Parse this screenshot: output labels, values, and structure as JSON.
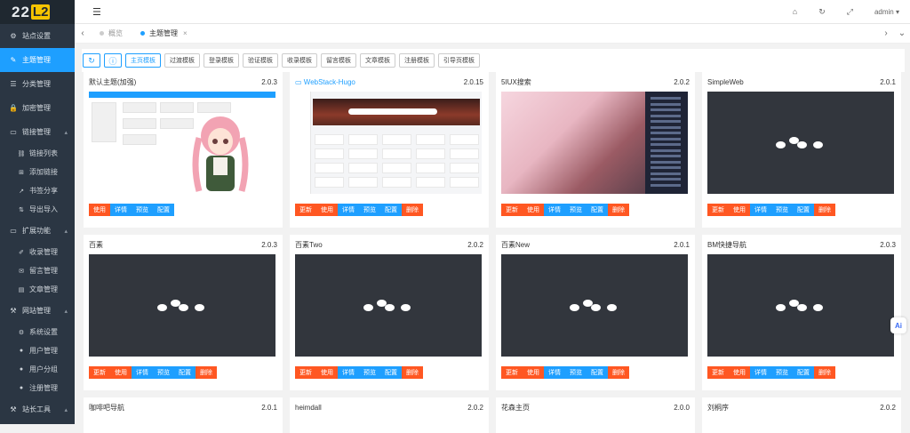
{
  "logo": {
    "text_a": "22",
    "text_b": "L2"
  },
  "header": {
    "user": "admin",
    "user_caret": "▾"
  },
  "tabs": [
    {
      "label": "概览",
      "active": false
    },
    {
      "label": "主题管理",
      "active": true,
      "close": "×"
    }
  ],
  "sidebar": {
    "items": [
      {
        "label": "站点设置",
        "icon": "gear-icon",
        "glyph": "⚙"
      },
      {
        "label": "主题管理",
        "icon": "brush-icon",
        "glyph": "✎",
        "active": true
      },
      {
        "label": "分类管理",
        "icon": "list-icon",
        "glyph": "☰"
      },
      {
        "label": "加密管理",
        "icon": "lock-icon",
        "glyph": "🔒"
      },
      {
        "label": "链接管理",
        "icon": "folder-icon",
        "glyph": "▭",
        "arrow": "▴"
      },
      {
        "label": "链接列表",
        "icon": "link-icon",
        "glyph": "⛓",
        "sub": true
      },
      {
        "label": "添加链接",
        "icon": "plus-square-icon",
        "glyph": "⊞",
        "sub": true
      },
      {
        "label": "书签分享",
        "icon": "share-icon",
        "glyph": "↗",
        "sub": true
      },
      {
        "label": "导出导入",
        "icon": "swap-icon",
        "glyph": "⇅",
        "sub": true
      },
      {
        "label": "扩展功能",
        "icon": "folder-icon",
        "glyph": "▭",
        "arrow": "▴"
      },
      {
        "label": "收录管理",
        "icon": "pencil-icon",
        "glyph": "✐",
        "sub": true
      },
      {
        "label": "留言管理",
        "icon": "message-icon",
        "glyph": "✉",
        "sub": true
      },
      {
        "label": "文章管理",
        "icon": "doc-icon",
        "glyph": "▤",
        "sub": true
      },
      {
        "label": "网站管理",
        "icon": "wrench-icon",
        "glyph": "⚒",
        "arrow": "▴"
      },
      {
        "label": "系统设置",
        "icon": "cogs-icon",
        "glyph": "⚙",
        "sub": true
      },
      {
        "label": "用户管理",
        "icon": "user-icon",
        "glyph": "●",
        "sub": true
      },
      {
        "label": "用户分组",
        "icon": "users-icon",
        "glyph": "●",
        "sub": true
      },
      {
        "label": "注册管理",
        "icon": "user-plus-icon",
        "glyph": "●",
        "sub": true
      },
      {
        "label": "站长工具",
        "icon": "tools-icon",
        "glyph": "⚒",
        "arrow": "▴"
      }
    ]
  },
  "toolbar": {
    "refresh_glyph": "↻",
    "info_glyph": "ⓘ",
    "buttons": [
      "主页模板",
      "过渡模板",
      "登录模板",
      "验证模板",
      "收录模板",
      "留言模板",
      "文章模板",
      "注册模板",
      "引导页模板"
    ]
  },
  "cards": [
    {
      "name": "默认主题(加强)",
      "version": "2.0.3",
      "thumb": "default",
      "actions": [
        "使用",
        "详情",
        "预览",
        "配置"
      ]
    },
    {
      "name": "WebStack-Hugo",
      "version": "2.0.15",
      "thumb": "webstack",
      "link": true,
      "actions": [
        "更新",
        "使用",
        "详情",
        "预览",
        "配置",
        "删除"
      ]
    },
    {
      "name": "5IUX搜索",
      "version": "2.0.2",
      "thumb": "5iux",
      "actions": [
        "更新",
        "使用",
        "详情",
        "预览",
        "配置",
        "删除"
      ]
    },
    {
      "name": "SimpleWeb",
      "version": "2.0.1",
      "thumb": "loading",
      "actions": [
        "更新",
        "使用",
        "详情",
        "预览",
        "配置",
        "删除"
      ]
    },
    {
      "name": "百素",
      "version": "2.0.3",
      "thumb": "loading",
      "actions": [
        "更新",
        "使用",
        "详情",
        "预览",
        "配置",
        "删除"
      ]
    },
    {
      "name": "百素Two",
      "version": "2.0.2",
      "thumb": "loading",
      "actions": [
        "更新",
        "使用",
        "详情",
        "预览",
        "配置",
        "删除"
      ]
    },
    {
      "name": "百素New",
      "version": "2.0.1",
      "thumb": "loading",
      "actions": [
        "更新",
        "使用",
        "详情",
        "预览",
        "配置",
        "删除"
      ]
    },
    {
      "name": "BM快捷导航",
      "version": "2.0.3",
      "thumb": "loading",
      "actions": [
        "更新",
        "使用",
        "详情",
        "预览",
        "配置",
        "删除"
      ]
    },
    {
      "name": "咖啡吧导航",
      "version": "2.0.1",
      "short": true
    },
    {
      "name": "heimdall",
      "version": "2.0.2",
      "short": true
    },
    {
      "name": "花森主页",
      "version": "2.0.0",
      "short": true
    },
    {
      "name": "刘桐序",
      "version": "2.0.2",
      "short": true
    }
  ],
  "action_colors": {
    "更新": "#ff5722",
    "使用": "#ff5722",
    "详情": "#1e9fff",
    "预览": "#1e9fff",
    "配置": "#1e9fff",
    "删除": "#ff5722"
  },
  "ai_badge": "Ai"
}
